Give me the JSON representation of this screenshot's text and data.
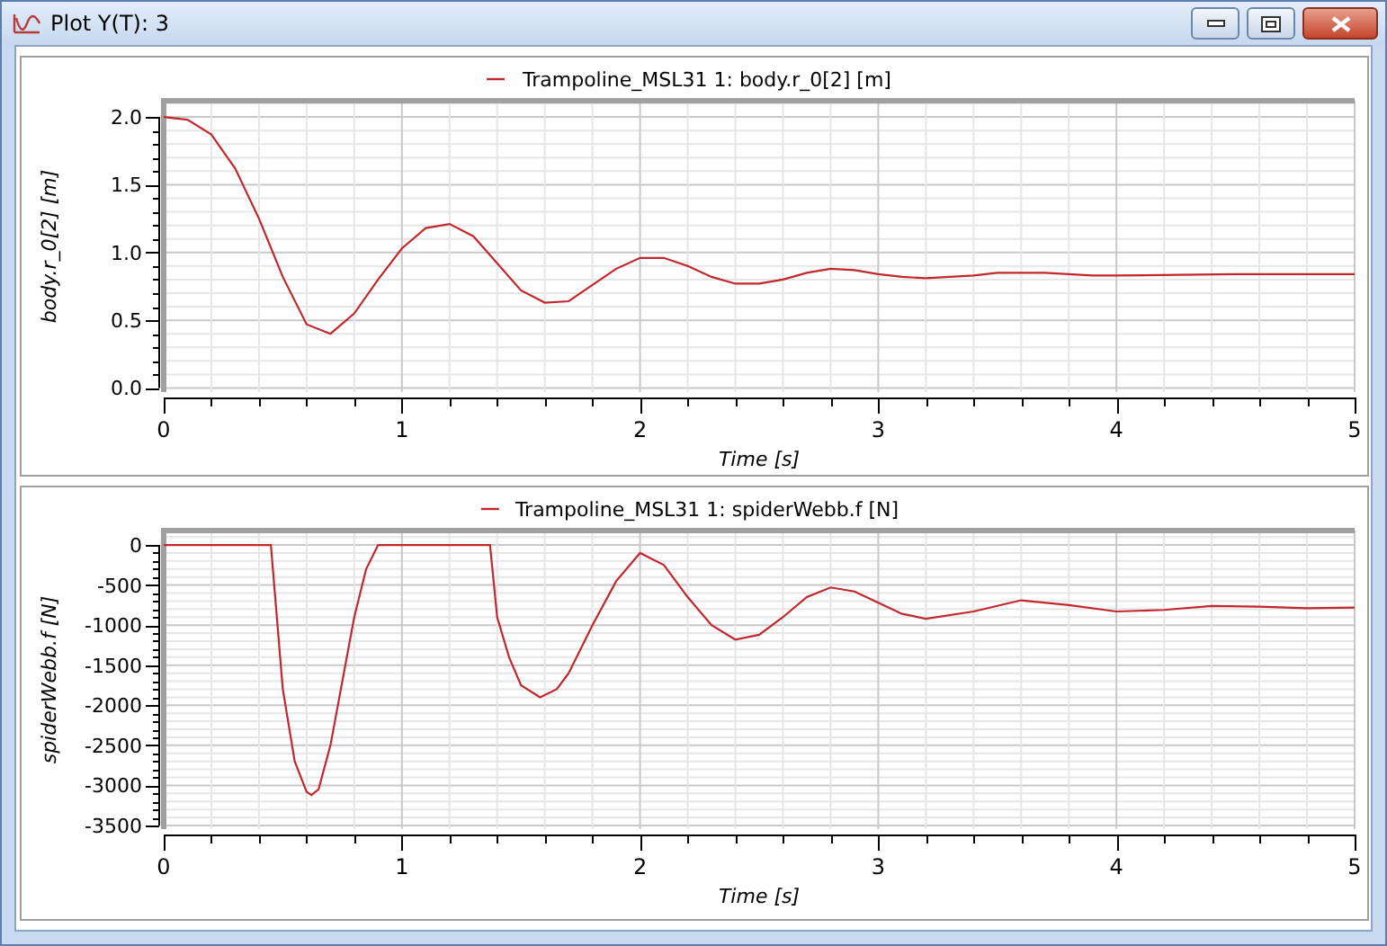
{
  "window": {
    "title": "Plot Y(T): 3"
  },
  "plots": [
    {
      "chart_data": {
        "type": "line",
        "grid": true,
        "xlabel": "Time [s]",
        "ylabel": "body.r_0[2] [m]",
        "xlim": [
          0,
          5
        ],
        "ylim": [
          -0.03,
          2.12
        ],
        "xticks": [
          0,
          1,
          2,
          3,
          4,
          5
        ],
        "yticks": [
          {
            "value": 0,
            "label": "0.0"
          },
          {
            "value": 0.5,
            "label": "0.5"
          },
          {
            "value": 1,
            "label": "1.0"
          },
          {
            "value": 1.5,
            "label": "1.5"
          },
          {
            "value": 2,
            "label": "2.0"
          }
        ],
        "x": [
          0,
          0.1,
          0.2,
          0.3,
          0.4,
          0.5,
          0.6,
          0.7,
          0.8,
          0.9,
          1,
          1.1,
          1.2,
          1.3,
          1.4,
          1.5,
          1.6,
          1.7,
          1.8,
          1.9,
          2,
          2.1,
          2.2,
          2.3,
          2.4,
          2.5,
          2.6,
          2.7,
          2.8,
          2.9,
          3,
          3.1,
          3.2,
          3.3,
          3.4,
          3.5,
          3.6,
          3.7,
          3.8,
          3.9,
          4,
          4.5,
          5
        ],
        "series": [
          {
            "name": "Trampoline_MSL31 1: body.r_0[2] [m]",
            "color": "#c0282d",
            "values": [
              2.0,
              1.98,
              1.87,
              1.62,
              1.25,
              0.82,
              0.47,
              0.4,
              0.55,
              0.8,
              1.03,
              1.18,
              1.21,
              1.12,
              0.92,
              0.72,
              0.63,
              0.64,
              0.76,
              0.88,
              0.96,
              0.96,
              0.9,
              0.82,
              0.77,
              0.77,
              0.8,
              0.85,
              0.88,
              0.87,
              0.84,
              0.82,
              0.81,
              0.82,
              0.83,
              0.85,
              0.85,
              0.85,
              0.84,
              0.83,
              0.83,
              0.84,
              0.84
            ]
          }
        ]
      }
    },
    {
      "chart_data": {
        "type": "line",
        "grid": true,
        "xlabel": "Time [s]",
        "ylabel": "spiderWebb.f [N]",
        "xlim": [
          0,
          5
        ],
        "ylim": [
          -3545,
          180
        ],
        "xticks": [
          0,
          1,
          2,
          3,
          4,
          5
        ],
        "yticks": [
          -3500,
          -3000,
          -2500,
          -2000,
          -1500,
          -1000,
          -500,
          0
        ],
        "x": [
          0,
          0.45,
          0.5,
          0.55,
          0.6,
          0.62,
          0.65,
          0.7,
          0.75,
          0.8,
          0.85,
          0.9,
          1.37,
          1.4,
          1.45,
          1.5,
          1.58,
          1.65,
          1.7,
          1.8,
          1.9,
          2,
          2.1,
          2.2,
          2.3,
          2.4,
          2.5,
          2.6,
          2.7,
          2.8,
          2.9,
          3,
          3.1,
          3.2,
          3.4,
          3.6,
          3.8,
          4,
          4.2,
          4.4,
          4.6,
          4.8,
          5
        ],
        "series": [
          {
            "name": "Trampoline_MSL31 1: spiderWebb.f [N]",
            "color": "#c0282d",
            "values": [
              0,
              0,
              -1800,
              -2700,
              -3080,
              -3120,
              -3050,
              -2500,
              -1700,
              -900,
              -300,
              0,
              0,
              -900,
              -1400,
              -1750,
              -1900,
              -1800,
              -1600,
              -1000,
              -450,
              -100,
              -250,
              -650,
              -1000,
              -1180,
              -1120,
              -900,
              -650,
              -530,
              -580,
              -720,
              -860,
              -920,
              -830,
              -690,
              -750,
              -830,
              -810,
              -760,
              -770,
              -790,
              -780
            ]
          }
        ]
      }
    }
  ]
}
